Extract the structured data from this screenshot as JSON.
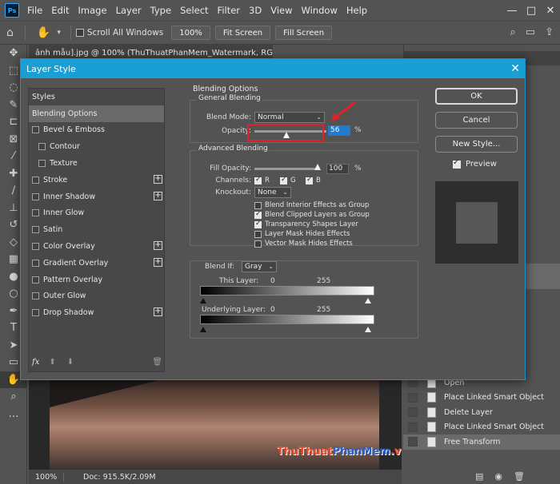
{
  "app": {
    "logo": "Ps",
    "menu": [
      "File",
      "Edit",
      "Image",
      "Layer",
      "Type",
      "Select",
      "Filter",
      "3D",
      "View",
      "Window",
      "Help"
    ],
    "window_controls": [
      "—",
      "□",
      "✕"
    ]
  },
  "options_bar": {
    "scroll_all_windows": "Scroll All Windows",
    "zoom_100": "100%",
    "fit_screen": "Fit Screen",
    "fill_screen": "Fill Screen"
  },
  "document": {
    "tab_title": "ảnh mẫu].jpg @ 100% (ThuThuatPhanMem_Watermark, RGB/8#) *",
    "tab_close": "×",
    "zoom": "100%",
    "doc_size": "Doc: 915.5K/2.09M",
    "watermark_part1": "ThuThuat",
    "watermark_part2": "PhanMem",
    "watermark_part3": ".vn"
  },
  "history": {
    "items": [
      "Open",
      "Place Linked Smart Object",
      "Delete Layer",
      "Place Linked Smart Object",
      "Free Transform"
    ]
  },
  "colors": {
    "dialog_title_bg": "#1a9fd4",
    "highlight_red": "#e0212b",
    "foreground": "#111111",
    "background": "#a30f15"
  },
  "dialog": {
    "title": "Layer Style",
    "close": "✕",
    "styles_header": "Styles",
    "styles": [
      {
        "label": "Blending Options",
        "checkbox": false,
        "plus": false,
        "selected": true
      },
      {
        "label": "Bevel & Emboss",
        "checkbox": true,
        "plus": false
      },
      {
        "label": "Contour",
        "checkbox": true,
        "plus": false,
        "sub": true
      },
      {
        "label": "Texture",
        "checkbox": true,
        "plus": false,
        "sub": true
      },
      {
        "label": "Stroke",
        "checkbox": true,
        "plus": true
      },
      {
        "label": "Inner Shadow",
        "checkbox": true,
        "plus": true
      },
      {
        "label": "Inner Glow",
        "checkbox": true,
        "plus": false
      },
      {
        "label": "Satin",
        "checkbox": true,
        "plus": false
      },
      {
        "label": "Color Overlay",
        "checkbox": true,
        "plus": true
      },
      {
        "label": "Gradient Overlay",
        "checkbox": true,
        "plus": true
      },
      {
        "label": "Pattern Overlay",
        "checkbox": true,
        "plus": false
      },
      {
        "label": "Outer Glow",
        "checkbox": true,
        "plus": false
      },
      {
        "label": "Drop Shadow",
        "checkbox": true,
        "plus": true
      }
    ],
    "fx": "fx",
    "blending": {
      "section_title": "Blending Options",
      "general_title": "General Blending",
      "blend_mode_label": "Blend Mode:",
      "blend_mode_value": "Normal",
      "opacity_label": "Opacity:",
      "opacity_value": "56",
      "percent": "%",
      "advanced_title": "Advanced Blending",
      "fill_opacity_label": "Fill Opacity:",
      "fill_opacity_value": "100",
      "channels_label": "Channels:",
      "channels": [
        "R",
        "G",
        "B"
      ],
      "knockout_label": "Knockout:",
      "knockout_value": "None",
      "advanced_options": [
        {
          "label": "Blend Interior Effects as Group",
          "checked": false
        },
        {
          "label": "Blend Clipped Layers as Group",
          "checked": true
        },
        {
          "label": "Transparency Shapes Layer",
          "checked": true
        },
        {
          "label": "Layer Mask Hides Effects",
          "checked": false
        },
        {
          "label": "Vector Mask Hides Effects",
          "checked": false
        }
      ],
      "blend_if_label": "Blend If:",
      "blend_if_value": "Gray",
      "this_layer_label": "This Layer:",
      "this_layer_min": "0",
      "this_layer_max": "255",
      "underlying_label": "Underlying Layer:",
      "underlying_min": "0",
      "underlying_max": "255"
    },
    "buttons": {
      "ok": "OK",
      "cancel": "Cancel",
      "new_style": "New Style...",
      "preview": "Preview"
    }
  }
}
